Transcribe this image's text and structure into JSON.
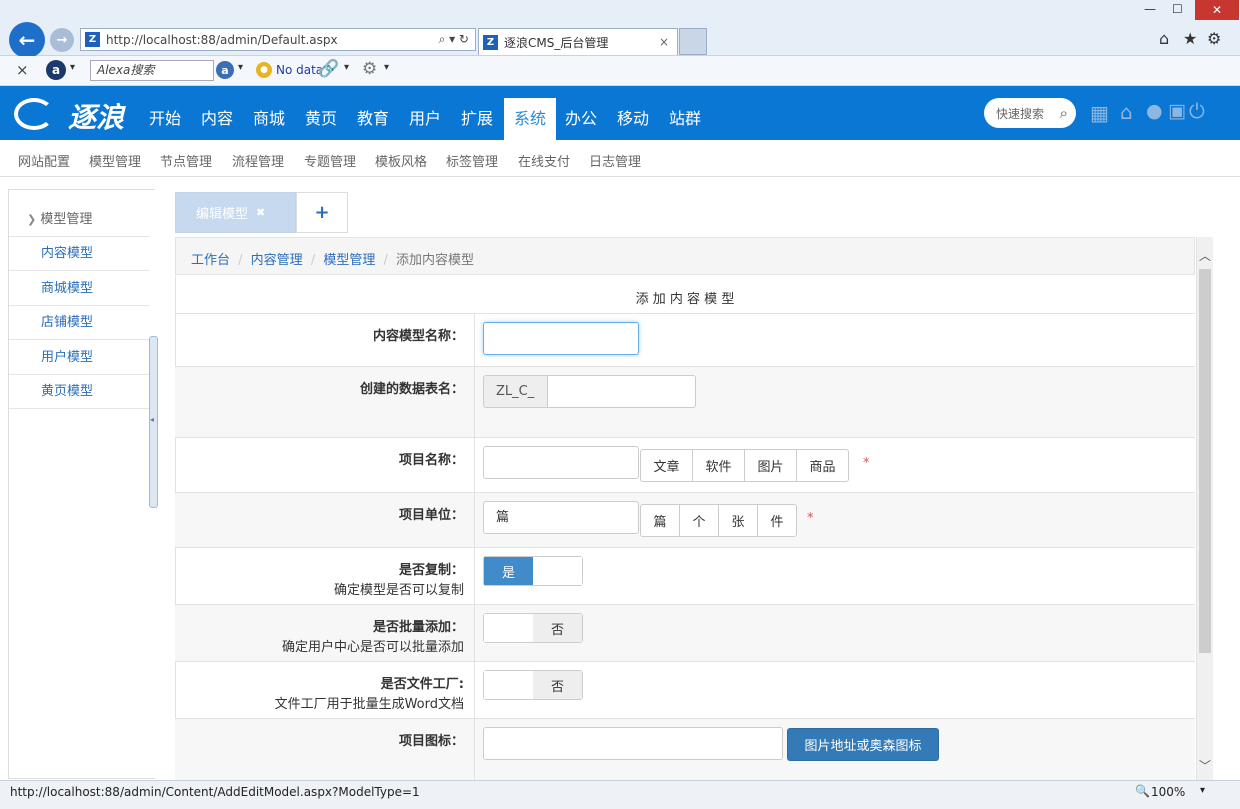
{
  "browser": {
    "url": "http://localhost:88/admin/Default.aspx",
    "tab_title": "逐浪CMS_后台管理",
    "tab_close": "×",
    "alexa_placeholder": "Alexa搜索",
    "no_data": "No data",
    "back_icon": "←",
    "forward_icon": "→",
    "close_x": "×",
    "minimize": "—",
    "maximize": "☐",
    "close_window": "✕"
  },
  "header": {
    "logo_text": "逐浪",
    "nav": [
      "开始",
      "内容",
      "商城",
      "黄页",
      "教育",
      "用户",
      "扩展",
      "系统",
      "办公",
      "移动",
      "站群"
    ],
    "active_index": 7,
    "quick_search": "快速搜索"
  },
  "subnav": [
    "网站配置",
    "模型管理",
    "节点管理",
    "流程管理",
    "专题管理",
    "模板风格",
    "标签管理",
    "在线支付",
    "日志管理"
  ],
  "sidebar": {
    "title": "模型管理",
    "items": [
      "内容模型",
      "商城模型",
      "店铺模型",
      "用户模型",
      "黄页模型"
    ]
  },
  "tabs": {
    "edit_model": "编辑模型",
    "close": "✖",
    "add": "+"
  },
  "breadcrumb": [
    "工作台",
    "内容管理",
    "模型管理",
    "添加内容模型"
  ],
  "form": {
    "title": "添 加 内 容 模 型",
    "model_name_label": "内容模型名称：",
    "table_name_label": "创建的数据表名：",
    "table_prefix": "ZL_C_",
    "item_name_label": "项目名称：",
    "item_name_options": [
      "文章",
      "软件",
      "图片",
      "商品"
    ],
    "item_unit_label": "项目单位：",
    "item_unit_value": "篇",
    "item_unit_options": [
      "篇",
      "个",
      "张",
      "件"
    ],
    "required": "*",
    "copy_label": "是否复制：",
    "copy_desc": "确定模型是否可以复制",
    "copy_value": "是",
    "batch_label": "是否批量添加：",
    "batch_desc": "确定用户中心是否可以批量添加",
    "batch_value": "否",
    "factory_label": "是否文件工厂:",
    "factory_desc": "文件工厂用于批量生成Word文档",
    "factory_value": "否",
    "icon_label": "项目图标：",
    "icon_button": "图片地址或奥森图标"
  },
  "status": {
    "url": "http://localhost:88/admin/Content/AddEditModel.aspx?ModelType=1",
    "zoom": "100%"
  },
  "colors": {
    "brand": "#0a77d5",
    "active_nav_text": "#2a8ad6",
    "primary_button": "#337ab7",
    "link": "#2a6ebb"
  }
}
